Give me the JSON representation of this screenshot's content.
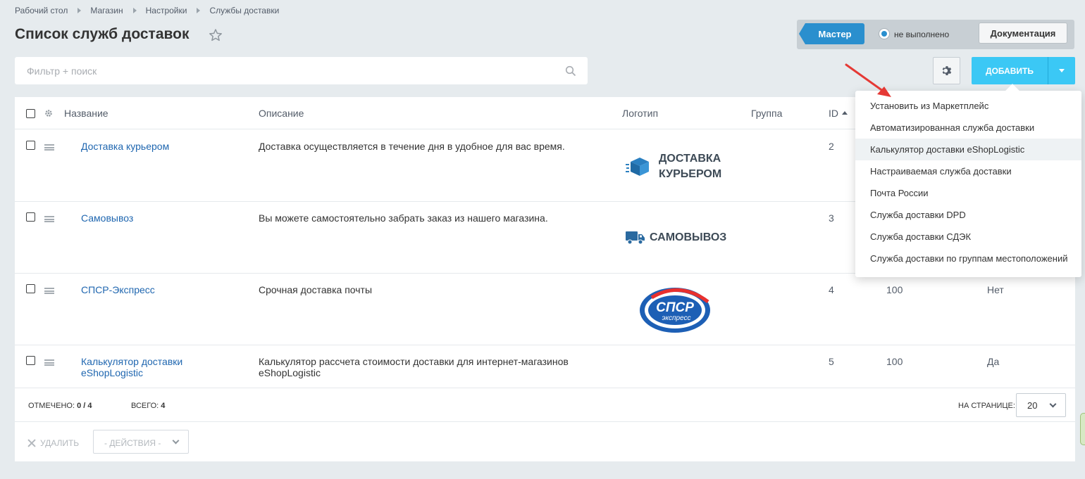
{
  "breadcrumb": [
    "Рабочий стол",
    "Магазин",
    "Настройки",
    "Службы доставки"
  ],
  "page_title": "Список служб доставок",
  "master": {
    "button_label": "Мастер",
    "status": "не выполнено",
    "docs_label": "Документация"
  },
  "search": {
    "placeholder": "Фильтр + поиск"
  },
  "add_button": "ДОБАВИТЬ",
  "columns": {
    "name": "Название",
    "description": "Описание",
    "logo": "Логотип",
    "group": "Группа",
    "id": "ID"
  },
  "rows": [
    {
      "name": "Доставка курьером",
      "description": "Доставка осуществляется в течение дня в удобное для вас время.",
      "logo_text": [
        "ДОСТАВКА",
        "КУРЬЕРОМ"
      ],
      "id": "2",
      "sort": "",
      "active": ""
    },
    {
      "name": "Самовывоз",
      "description": "Вы можете самостоятельно забрать заказ из нашего магазина.",
      "logo_text": [
        "САМОВЫВОЗ"
      ],
      "id": "3",
      "sort": "",
      "active": ""
    },
    {
      "name": "СПСР-Экспресс",
      "description": "Срочная доставка почты",
      "logo_text": [
        "СПСР",
        "экспресс"
      ],
      "id": "4",
      "sort": "100",
      "active": "Нет"
    },
    {
      "name": "Калькулятор доставки eShopLogistic",
      "description": "Калькулятор рассчета стоимости доставки для интернет-магазинов eShopLogistic",
      "logo_text": [],
      "id": "5",
      "sort": "100",
      "active": "Да"
    }
  ],
  "footer": {
    "selected_label": "ОТМЕЧЕНО:",
    "selected_value": "0 / 4",
    "total_label": "ВСЕГО:",
    "total_value": "4",
    "per_page_label": "НА СТРАНИЦЕ:",
    "per_page_value": "20"
  },
  "actions": {
    "delete_label": "УДАЛИТЬ",
    "select_label": "- ДЕЙСТВИЯ -"
  },
  "dropdown": {
    "items": [
      "Установить из Маркетплейс",
      "Автоматизированная служба доставки",
      "Калькулятор доставки eShopLogistic",
      "Настраиваемая служба доставки",
      "Почта России",
      "Служба доставки DPD",
      "Служба доставки СДЭК",
      "Служба доставки по группам местоположений"
    ],
    "highlighted_index": 2
  },
  "colors": {
    "accent_blue": "#3bc8f5",
    "master_blue": "#2a8fce",
    "link": "#2067b0",
    "annotation_arrow": "#e53935"
  }
}
